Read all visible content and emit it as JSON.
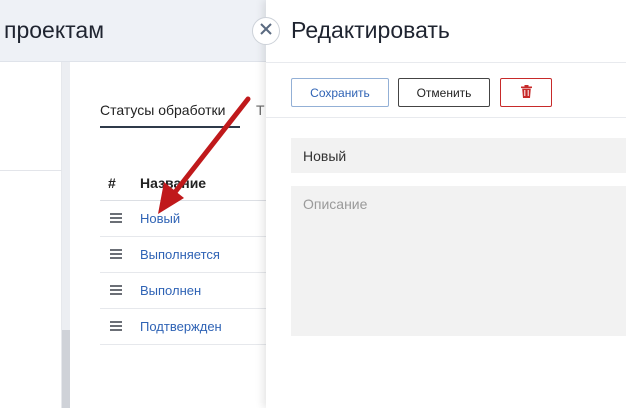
{
  "background": {
    "page_title": "проектам",
    "tabs": [
      {
        "label": "Статусы обработки"
      },
      {
        "label": "Т"
      }
    ],
    "table": {
      "columns": [
        "#",
        "Название"
      ],
      "rows": [
        {
          "name": "Новый"
        },
        {
          "name": "Выполняется"
        },
        {
          "name": "Выполнен"
        },
        {
          "name": "Подтвержден"
        }
      ]
    }
  },
  "drawer": {
    "title": "Редактировать",
    "save_label": "Сохранить",
    "cancel_label": "Отменить",
    "delete_icon": "trash-icon",
    "name_value": "Новый",
    "description_placeholder": "Описание",
    "close_icon": "close-icon"
  },
  "colors": {
    "link": "#2f63b5",
    "danger": "#c72a2a",
    "annotation_arrow": "#c0191b"
  }
}
